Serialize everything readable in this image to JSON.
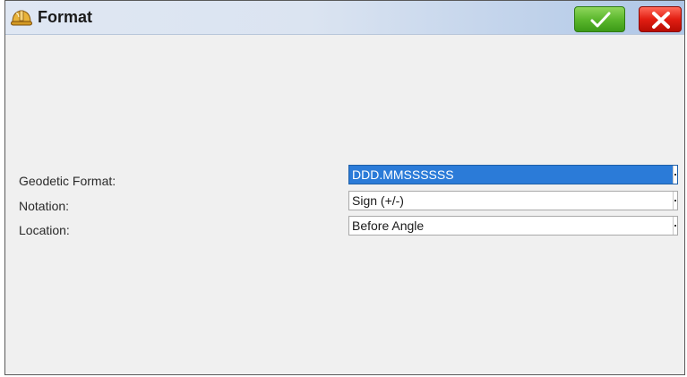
{
  "window": {
    "title": "Format"
  },
  "toolbar": {
    "ok_icon": "checkmark-icon",
    "cancel_icon": "close-icon",
    "ok_color": "#5cb82e",
    "cancel_color": "#e21e12"
  },
  "form": {
    "fields": [
      {
        "label": "Geodetic Format:",
        "value": "DDD.MMSSSSSS",
        "selected": true
      },
      {
        "label": "Notation:",
        "value": "Sign (+/-)",
        "selected": false
      },
      {
        "label": "Location:",
        "value": "Before Angle",
        "selected": false
      }
    ]
  },
  "colors": {
    "selection": "#2b7bd8",
    "background": "#f0f0f0"
  }
}
